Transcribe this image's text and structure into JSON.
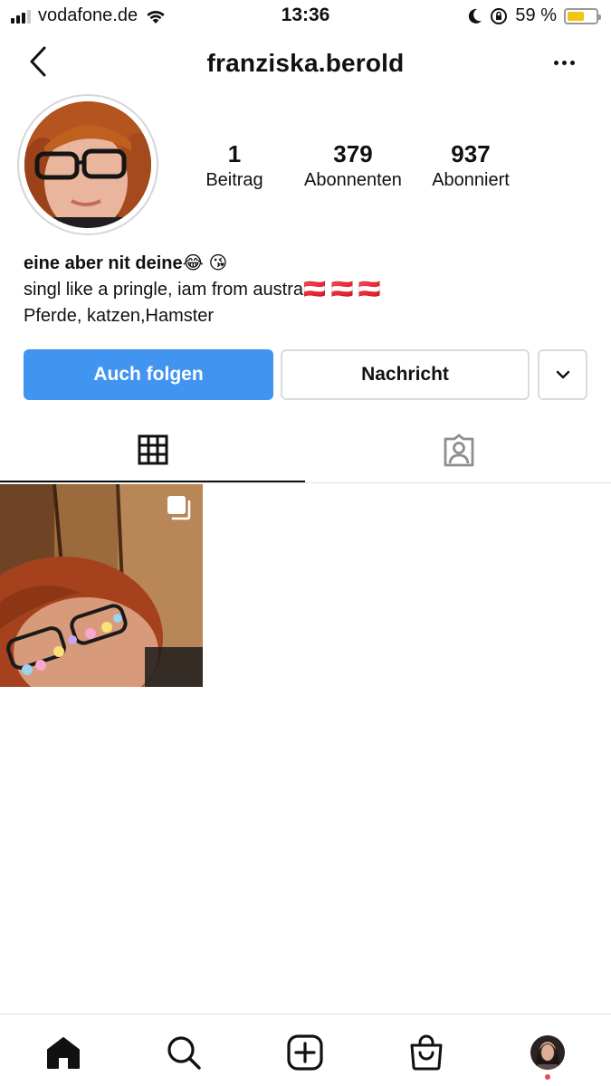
{
  "status_bar": {
    "carrier": "vodafone.de",
    "time": "13:36",
    "battery_percent": "59 %",
    "battery_level": 0.59,
    "battery_color": "#f2c511"
  },
  "header": {
    "username": "franziska.berold",
    "back_icon": "chevron-left-icon",
    "more_icon": "more-horizontal-icon"
  },
  "profile": {
    "stats": [
      {
        "value": "1",
        "label": "Beitrag"
      },
      {
        "value": "379",
        "label": "Abonnenten"
      },
      {
        "value": "937",
        "label": "Abonniert"
      }
    ],
    "bio_name": "eine aber nit deine😂 😘",
    "bio_lines": [
      "singl like a pringle, iam from austra🇦🇹 🇦🇹 🇦🇹",
      "Pferde, katzen,Hamster"
    ]
  },
  "actions": {
    "follow_label": "Auch folgen",
    "message_label": "Nachricht",
    "follow_color": "#4194f0"
  },
  "tabs": [
    {
      "icon": "grid-icon",
      "active": true
    },
    {
      "icon": "tagged-person-icon",
      "active": false
    }
  ],
  "posts": [
    {
      "icon": "multiple-photos-icon"
    }
  ],
  "bottom_nav": [
    {
      "icon": "home-icon",
      "active": true
    },
    {
      "icon": "search-icon"
    },
    {
      "icon": "new-post-icon"
    },
    {
      "icon": "shop-bag-icon"
    },
    {
      "icon": "profile-avatar-icon",
      "notification_dot": true
    }
  ]
}
